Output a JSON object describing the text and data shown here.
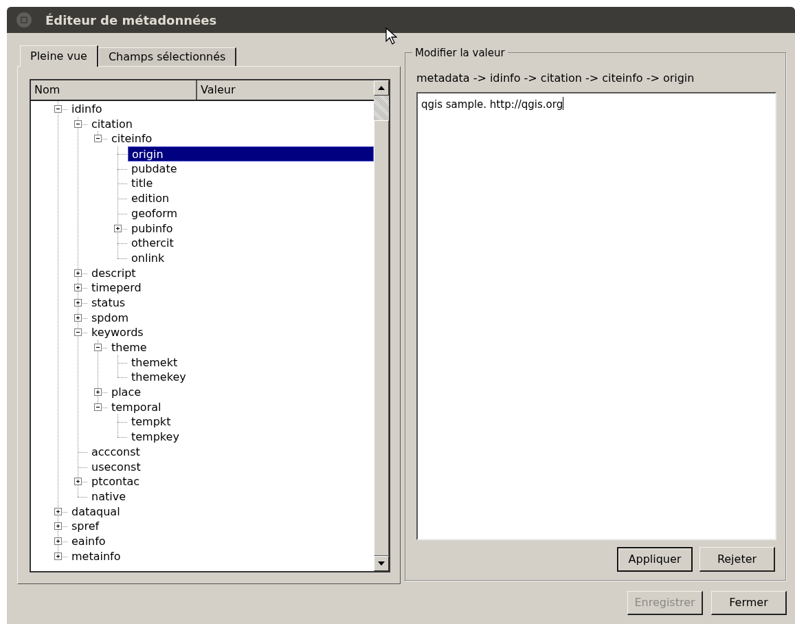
{
  "window": {
    "title": "Éditeur de métadonnées"
  },
  "tabs": [
    {
      "label": "Pleine vue",
      "selected": true
    },
    {
      "label": "Champs sélectionnés",
      "selected": false
    }
  ],
  "tree": {
    "columns": [
      "Nom",
      "Valeur"
    ],
    "nodes": [
      {
        "name": "idinfo",
        "selected": false,
        "expanded": true,
        "children": [
          {
            "name": "citation",
            "selected": false,
            "expanded": true,
            "children": [
              {
                "name": "citeinfo",
                "selected": false,
                "expanded": true,
                "children": [
                  {
                    "name": "origin",
                    "selected": true
                  },
                  {
                    "name": "pubdate",
                    "selected": false
                  },
                  {
                    "name": "title",
                    "selected": false
                  },
                  {
                    "name": "edition",
                    "selected": false
                  },
                  {
                    "name": "geoform",
                    "selected": false
                  },
                  {
                    "name": "pubinfo",
                    "selected": false,
                    "expanded": false
                  },
                  {
                    "name": "othercit",
                    "selected": false
                  },
                  {
                    "name": "onlink",
                    "selected": false
                  }
                ]
              }
            ]
          },
          {
            "name": "descript",
            "selected": false,
            "expanded": false
          },
          {
            "name": "timeperd",
            "selected": false,
            "expanded": false
          },
          {
            "name": "status",
            "selected": false,
            "expanded": false
          },
          {
            "name": "spdom",
            "selected": false,
            "expanded": false
          },
          {
            "name": "keywords",
            "selected": false,
            "expanded": true,
            "children": [
              {
                "name": "theme",
                "selected": false,
                "expanded": true,
                "children": [
                  {
                    "name": "themekt",
                    "selected": false
                  },
                  {
                    "name": "themekey",
                    "selected": false
                  }
                ]
              },
              {
                "name": "place",
                "selected": false,
                "expanded": false
              },
              {
                "name": "temporal",
                "selected": false,
                "expanded": true,
                "children": [
                  {
                    "name": "tempkt",
                    "selected": false
                  },
                  {
                    "name": "tempkey",
                    "selected": false
                  }
                ]
              }
            ]
          },
          {
            "name": "accconst",
            "selected": false
          },
          {
            "name": "useconst",
            "selected": false
          },
          {
            "name": "ptcontac",
            "selected": false,
            "expanded": false
          },
          {
            "name": "native",
            "selected": false
          }
        ]
      },
      {
        "name": "dataqual",
        "selected": false,
        "expanded": false
      },
      {
        "name": "spref",
        "selected": false,
        "expanded": false
      },
      {
        "name": "eainfo",
        "selected": false,
        "expanded": false
      },
      {
        "name": "metainfo",
        "selected": false,
        "expanded": false
      }
    ]
  },
  "editor": {
    "group_title": "Modifier la valeur",
    "path": "metadata -> idinfo -> citation -> citeinfo -> origin",
    "value": "qgis sample. http://qgis.org",
    "buttons": [
      {
        "label": "Appliquer",
        "default": true
      },
      {
        "label": "Rejeter",
        "default": false
      }
    ]
  },
  "footer_buttons": [
    {
      "label": "Enregistrer",
      "disabled": true
    },
    {
      "label": "Fermer",
      "disabled": false
    }
  ]
}
